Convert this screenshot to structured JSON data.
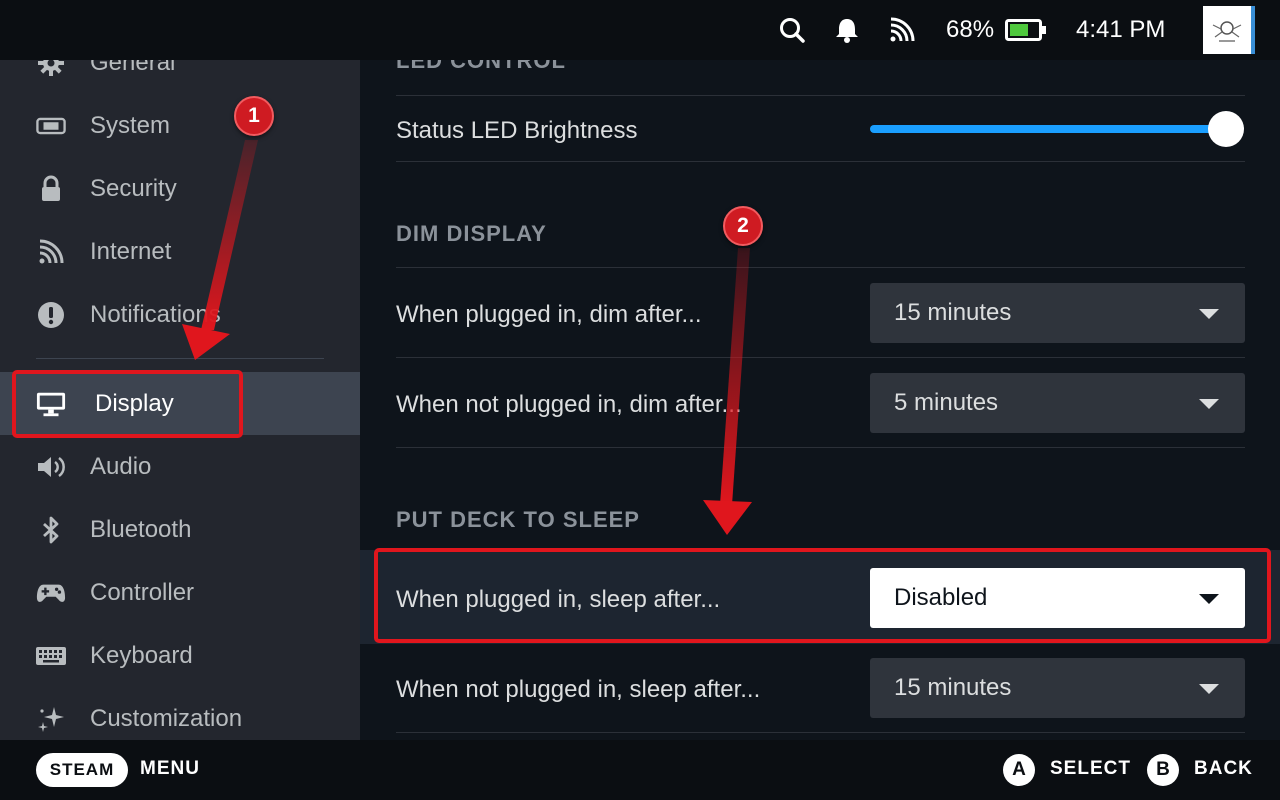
{
  "status_bar": {
    "icons": [
      "search-icon",
      "bell-icon",
      "wifi-icon",
      "battery-icon"
    ],
    "battery_percent": "68%",
    "battery_level": 0.68,
    "time": "4:41 PM"
  },
  "sidebar": {
    "items": [
      {
        "label": "General",
        "icon": "gear-icon"
      },
      {
        "label": "System",
        "icon": "system-icon"
      },
      {
        "label": "Security",
        "icon": "lock-icon"
      },
      {
        "label": "Internet",
        "icon": "wifi-icon"
      },
      {
        "label": "Notifications",
        "icon": "alert-icon"
      },
      {
        "label": "Display",
        "icon": "monitor-icon",
        "active": true
      },
      {
        "label": "Audio",
        "icon": "speaker-icon"
      },
      {
        "label": "Bluetooth",
        "icon": "bluetooth-icon"
      },
      {
        "label": "Controller",
        "icon": "gamepad-icon"
      },
      {
        "label": "Keyboard",
        "icon": "keyboard-icon"
      },
      {
        "label": "Customization",
        "icon": "sparkle-icon"
      }
    ]
  },
  "main": {
    "led_control": {
      "heading": "LED CONTROL",
      "brightness_label": "Status LED Brightness",
      "brightness_level": 1.0
    },
    "dim_display": {
      "heading": "DIM DISPLAY",
      "plugged_label": "When plugged in, dim after...",
      "plugged_value": "15 minutes",
      "unplugged_label": "When not plugged in, dim after...",
      "unplugged_value": "5 minutes"
    },
    "sleep": {
      "heading": "PUT DECK TO SLEEP",
      "plugged_label": "When plugged in, sleep after...",
      "plugged_value": "Disabled",
      "unplugged_label": "When not plugged in, sleep after...",
      "unplugged_value": "15 minutes"
    }
  },
  "bottom_bar": {
    "steam_label": "STEAM",
    "menu_label": "MENU",
    "a_button": "A",
    "select_label": "SELECT",
    "b_button": "B",
    "back_label": "BACK"
  },
  "annotations": {
    "badge_1": "1",
    "badge_2": "2",
    "color": "#e0161d"
  },
  "colors": {
    "accent": "#1a9fff",
    "sidebar_bg": "#23262e",
    "main_bg": "#0e141b"
  }
}
